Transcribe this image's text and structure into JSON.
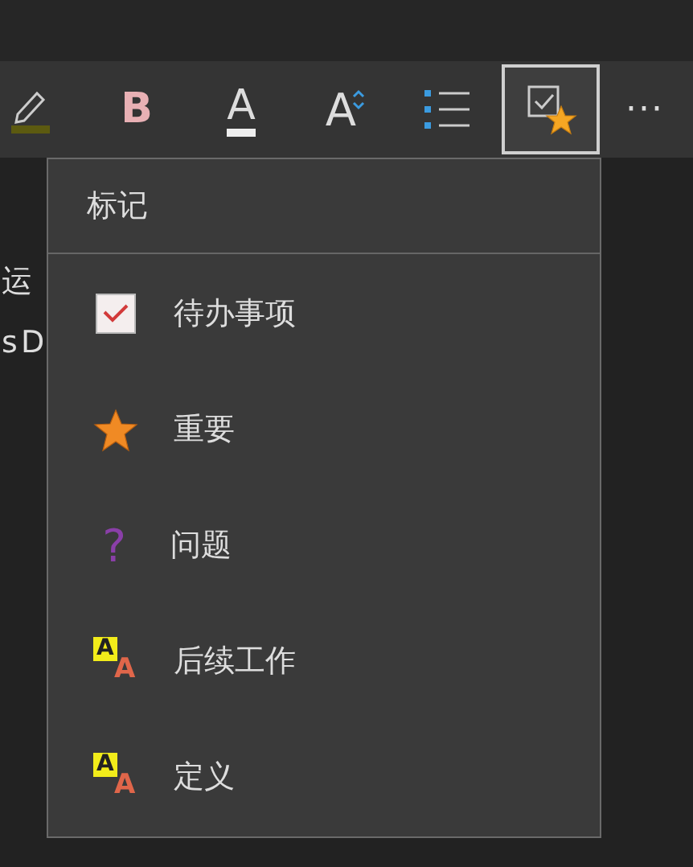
{
  "toolbar": [
    {
      "kind": "highlighter"
    },
    {
      "kind": "bold",
      "glyph": "B"
    },
    {
      "kind": "font-color",
      "glyph": "A"
    },
    {
      "kind": "font-size",
      "glyph": "A"
    },
    {
      "kind": "list"
    },
    {
      "kind": "tag",
      "selected": true
    },
    {
      "kind": "more",
      "glyph": "···"
    }
  ],
  "document": {
    "lines": [
      "运",
      "s D"
    ]
  },
  "tags_menu": {
    "title": "标记",
    "items": [
      {
        "kind": "todo",
        "label": "待办事项"
      },
      {
        "kind": "star",
        "label": "重要"
      },
      {
        "kind": "question",
        "label": "问题",
        "glyph": "?"
      },
      {
        "kind": "letters",
        "label": "后续工作",
        "glyphs": [
          "A",
          "A"
        ]
      },
      {
        "kind": "letters",
        "label": "定义",
        "glyphs": [
          "A",
          "A"
        ]
      }
    ]
  }
}
